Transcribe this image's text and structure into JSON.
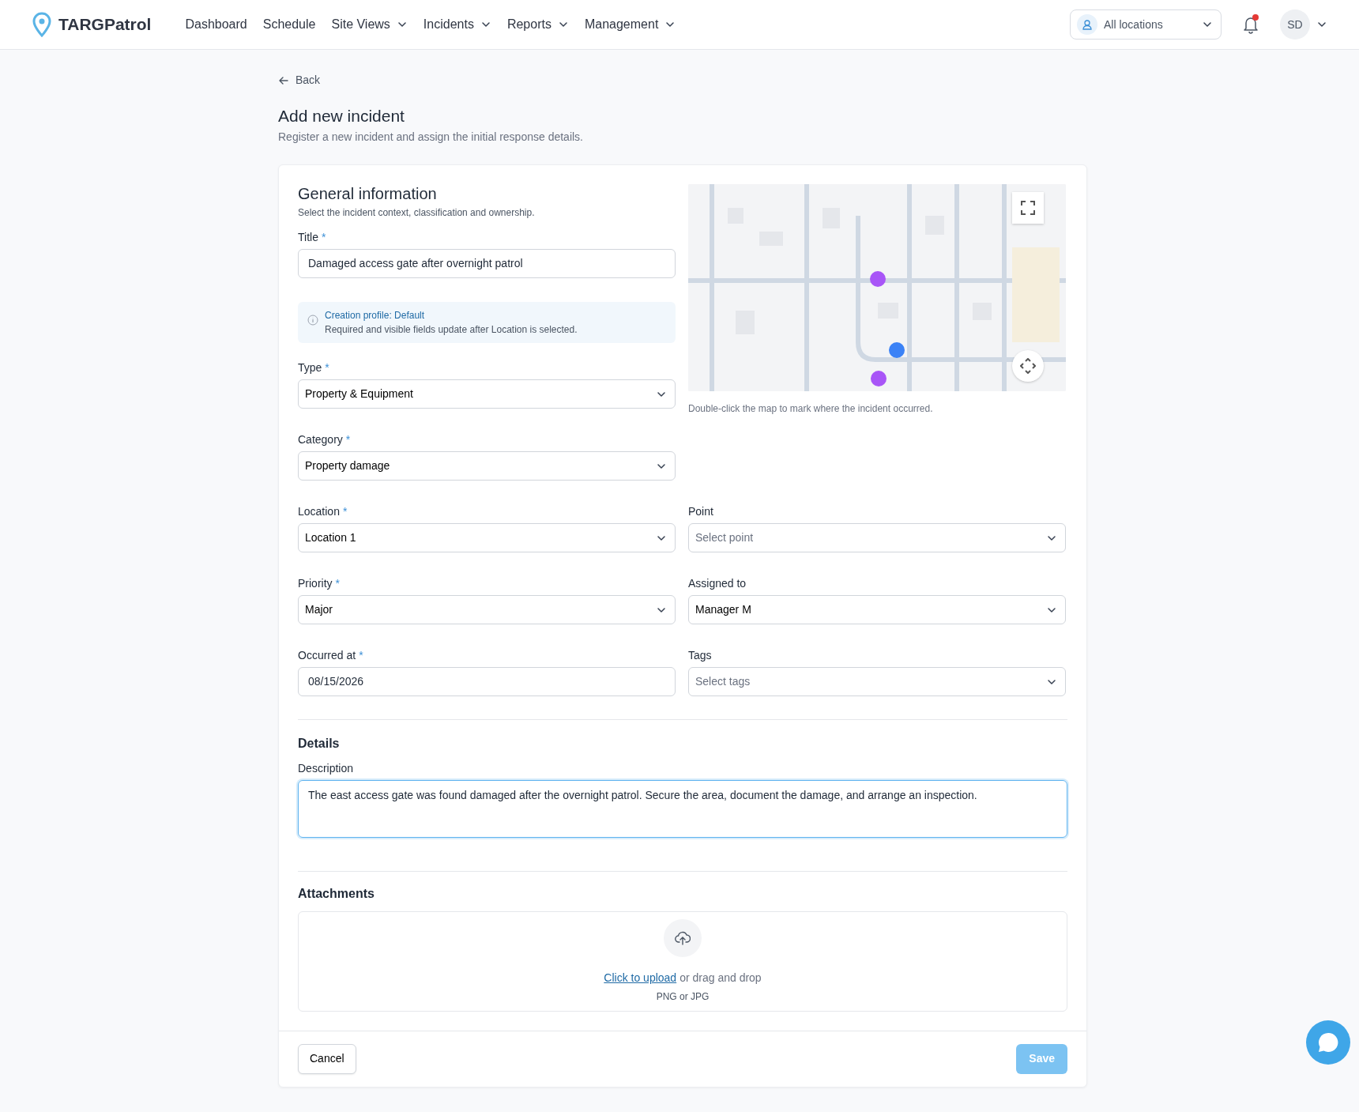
{
  "nav": {
    "brand": "TARGPatrol",
    "items": [
      {
        "label": "Dashboard",
        "dropdown": false
      },
      {
        "label": "Schedule",
        "dropdown": false
      },
      {
        "label": "Site Views",
        "dropdown": true
      },
      {
        "label": "Incidents",
        "dropdown": true
      },
      {
        "label": "Reports",
        "dropdown": true
      },
      {
        "label": "Management",
        "dropdown": true
      }
    ],
    "location_filter": {
      "value": "All locations"
    },
    "notifications": {
      "unread": true
    },
    "user": {
      "initials": "SD"
    }
  },
  "back": "Back",
  "page": {
    "title": "Add new incident",
    "subtitle": "Register a new incident and assign the initial response details."
  },
  "general": {
    "title": "General information",
    "subtitle": "Select the incident context, classification and ownership.",
    "title_field": {
      "label": "Title",
      "marker": "*",
      "value": "Damaged access gate after overnight patrol"
    },
    "info": {
      "heading": "Creation profile: Default",
      "text": "Required and visible fields update after Location is selected."
    },
    "map": {
      "hint": "Double-click the map to mark where the incident occurred."
    },
    "side_fields": [
      {
        "label": "Type",
        "marker": "*",
        "kind": "select",
        "value": "Property & Equipment"
      },
      {
        "label": "Category",
        "marker": "*",
        "kind": "select",
        "value": "Property damage"
      }
    ],
    "grid_fields": [
      {
        "label": "Location",
        "marker": "*",
        "kind": "select",
        "value": "Location 1"
      },
      {
        "label": "Point",
        "kind": "select",
        "placeholder": "Select point"
      },
      {
        "label": "Priority",
        "marker": "*",
        "kind": "select",
        "value": "Major"
      },
      {
        "label": "Assigned to",
        "kind": "select",
        "value": "Manager M"
      },
      {
        "label": "Occurred at",
        "marker": "*",
        "kind": "date",
        "value": "08/15/2026"
      },
      {
        "label": "Tags",
        "kind": "select",
        "placeholder": "Select tags"
      }
    ]
  },
  "details": {
    "title": "Details",
    "description": {
      "label": "Description",
      "value": "The east access gate was found damaged after the overnight patrol. Secure the area, document the damage, and arrange an inspection.",
      "focused": true
    }
  },
  "attachments": {
    "title": "Attachments",
    "link": "Click to upload",
    "text": "or drag and drop",
    "formats": "PNG or JPG"
  },
  "footer": {
    "cancel": "Cancel",
    "save": {
      "label": "Save",
      "disabled": true
    }
  }
}
